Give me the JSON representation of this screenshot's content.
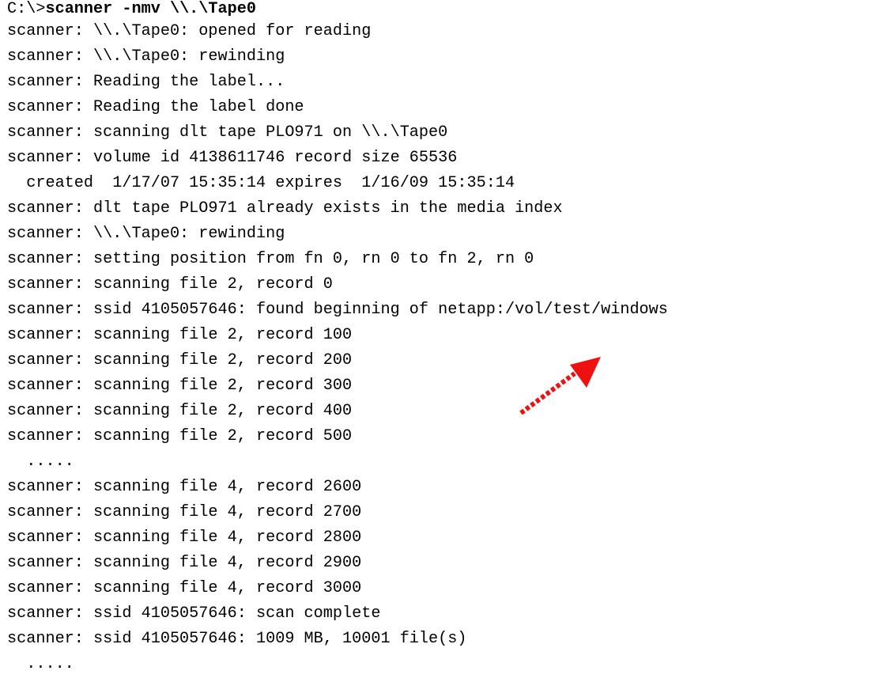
{
  "terminal": {
    "prompt": "C:\\>",
    "command": "scanner -nmv \\\\.\\Tape0",
    "lines": [
      "scanner: \\\\.\\Tape0: opened for reading",
      "scanner: \\\\.\\Tape0: rewinding",
      "scanner: Reading the label...",
      "scanner: Reading the label done",
      "scanner: scanning dlt tape PLO971 on \\\\.\\Tape0",
      "scanner: volume id 4138611746 record size 65536",
      "  created  1/17/07 15:35:14 expires  1/16/09 15:35:14",
      "scanner: dlt tape PLO971 already exists in the media index",
      "scanner: \\\\.\\Tape0: rewinding",
      "scanner: setting position from fn 0, rn 0 to fn 2, rn 0",
      "scanner: scanning file 2, record 0",
      "scanner: ssid 4105057646: found beginning of netapp:/vol/test/windows",
      "scanner: scanning file 2, record 100",
      "scanner: scanning file 2, record 200",
      "scanner: scanning file 2, record 300",
      "scanner: scanning file 2, record 400",
      "scanner: scanning file 2, record 500",
      "  .....",
      "scanner: scanning file 4, record 2600",
      "scanner: scanning file 4, record 2700",
      "scanner: scanning file 4, record 2800",
      "scanner: scanning file 4, record 2900",
      "scanner: scanning file 4, record 3000",
      "scanner: ssid 4105057646: scan complete",
      "scanner: ssid 4105057646: 1009 MB, 10001 file(s)",
      "  ....."
    ]
  },
  "annotation": {
    "arrow_color": "#ee1111",
    "icon": "dotted-arrow-icon"
  }
}
